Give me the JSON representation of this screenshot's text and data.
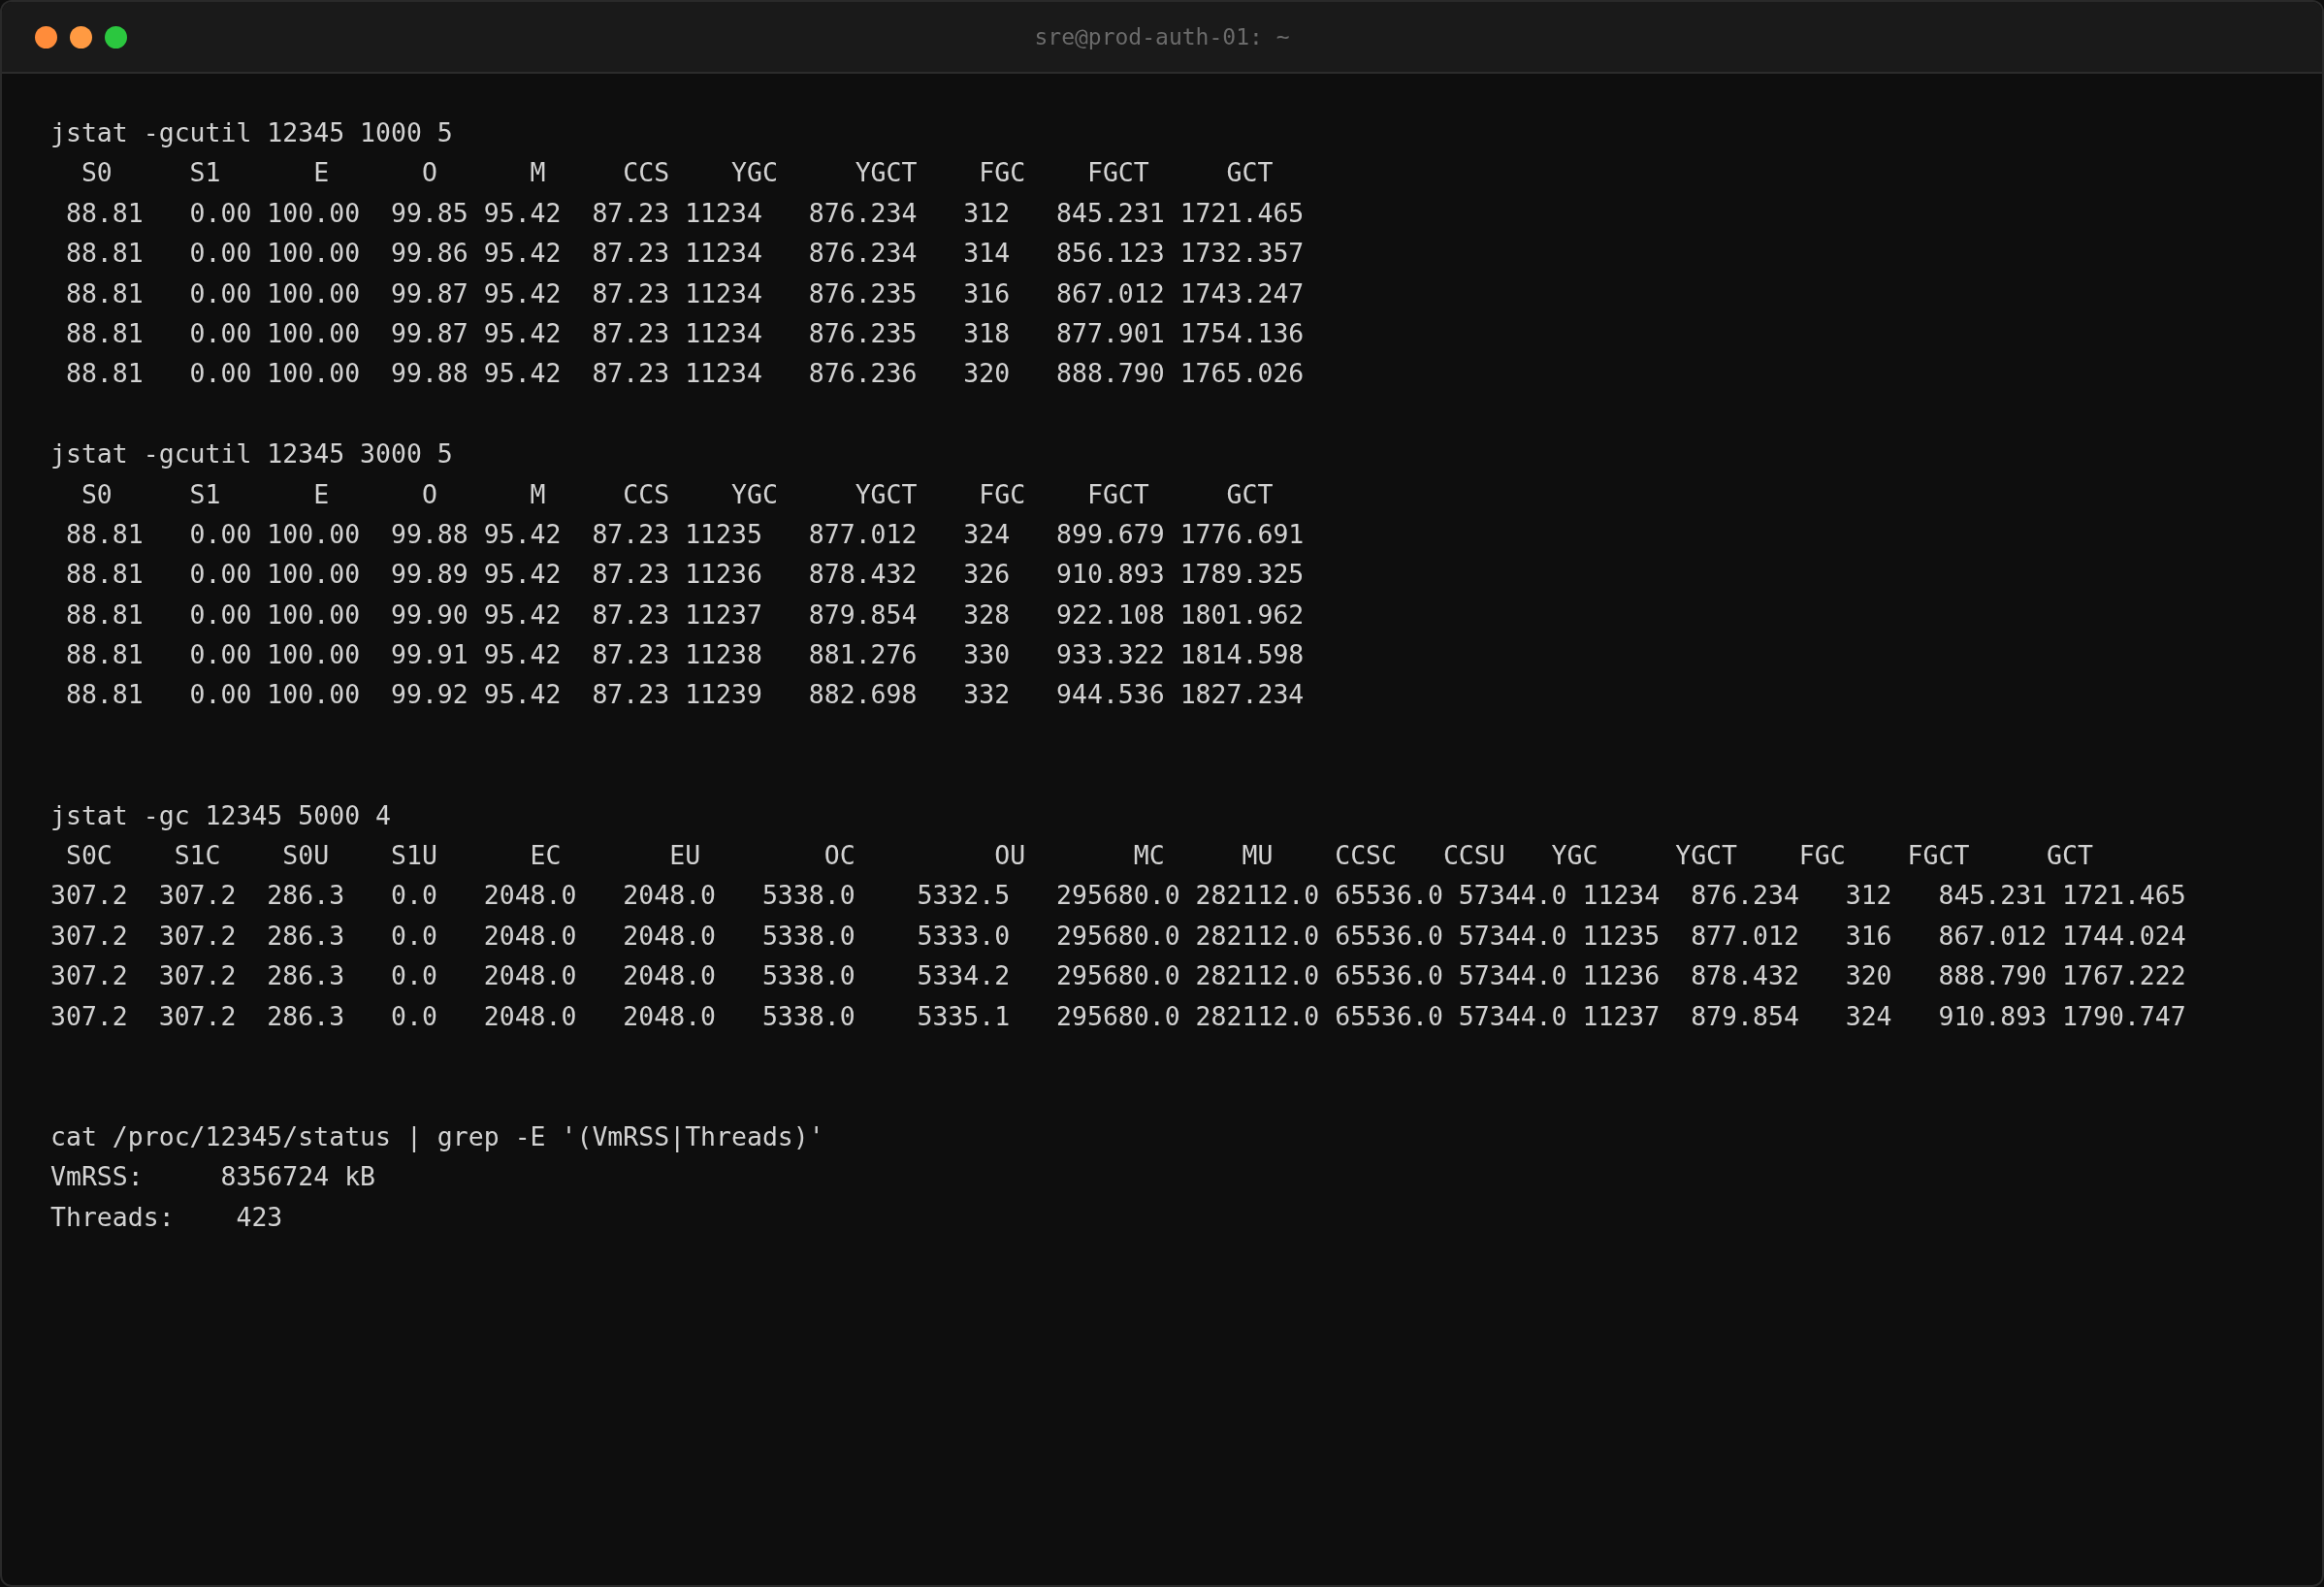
{
  "window": {
    "title": "sre@prod-auth-01: ~",
    "buttons": [
      {
        "color": "#ff8c3a"
      },
      {
        "color": "#ff9a42"
      },
      {
        "color": "#2bc73f"
      }
    ]
  },
  "terminal": {
    "lines": [
      {
        "kind": "text",
        "text": "jstat -gcutil 12345 1000 5"
      },
      {
        "kind": "text",
        "text": "  S0     S1      E      O      M     CCS    YGC     YGCT    FGC    FGCT     GCT"
      },
      {
        "kind": "text",
        "text": " 88.81   0.00 100.00  99.85 95.42  87.23 11234   876.234   312   845.231 1721.465"
      },
      {
        "kind": "text",
        "text": " 88.81   0.00 100.00  99.86 95.42  87.23 11234   876.234   314   856.123 1732.357"
      },
      {
        "kind": "text",
        "text": " 88.81   0.00 100.00  99.87 95.42  87.23 11234   876.235   316   867.012 1743.247"
      },
      {
        "kind": "text",
        "text": " 88.81   0.00 100.00  99.87 95.42  87.23 11234   876.235   318   877.901 1754.136"
      },
      {
        "kind": "text",
        "text": " 88.81   0.00 100.00  99.88 95.42  87.23 11234   876.236   320   888.790 1765.026"
      },
      {
        "kind": "blank"
      },
      {
        "kind": "text",
        "text": "jstat -gcutil 12345 3000 5"
      },
      {
        "kind": "text",
        "text": "  S0     S1      E      O      M     CCS    YGC     YGCT    FGC    FGCT     GCT"
      },
      {
        "kind": "text",
        "text": " 88.81   0.00 100.00  99.88 95.42  87.23 11235   877.012   324   899.679 1776.691"
      },
      {
        "kind": "text",
        "text": " 88.81   0.00 100.00  99.89 95.42  87.23 11236   878.432   326   910.893 1789.325"
      },
      {
        "kind": "text",
        "text": " 88.81   0.00 100.00  99.90 95.42  87.23 11237   879.854   328   922.108 1801.962"
      },
      {
        "kind": "text",
        "text": " 88.81   0.00 100.00  99.91 95.42  87.23 11238   881.276   330   933.322 1814.598"
      },
      {
        "kind": "text",
        "text": " 88.81   0.00 100.00  99.92 95.42  87.23 11239   882.698   332   944.536 1827.234"
      },
      {
        "kind": "blank"
      },
      {
        "kind": "blank"
      },
      {
        "kind": "text",
        "text": "jstat -gc 12345 5000 4"
      },
      {
        "kind": "text",
        "text": " S0C    S1C    S0U    S1U      EC       EU        OC         OU       MC     MU    CCSC   CCSU   YGC     YGCT    FGC    FGCT     GCT"
      },
      {
        "kind": "text",
        "text": "307.2  307.2  286.3   0.0   2048.0   2048.0   5338.0    5332.5   295680.0 282112.0 65536.0 57344.0 11234  876.234   312   845.231 1721.465"
      },
      {
        "kind": "text",
        "text": "307.2  307.2  286.3   0.0   2048.0   2048.0   5338.0    5333.0   295680.0 282112.0 65536.0 57344.0 11235  877.012   316   867.012 1744.024"
      },
      {
        "kind": "text",
        "text": "307.2  307.2  286.3   0.0   2048.0   2048.0   5338.0    5334.2   295680.0 282112.0 65536.0 57344.0 11236  878.432   320   888.790 1767.222"
      },
      {
        "kind": "text",
        "text": "307.2  307.2  286.3   0.0   2048.0   2048.0   5338.0    5335.1   295680.0 282112.0 65536.0 57344.0 11237  879.854   324   910.893 1790.747"
      },
      {
        "kind": "blank"
      },
      {
        "kind": "blank"
      },
      {
        "kind": "text",
        "text": "cat /proc/12345/status | grep -E '(VmRSS|Threads)'"
      },
      {
        "kind": "text",
        "text": "VmRSS:     8356724 kB"
      },
      {
        "kind": "text",
        "text": "Threads:    423"
      }
    ]
  }
}
